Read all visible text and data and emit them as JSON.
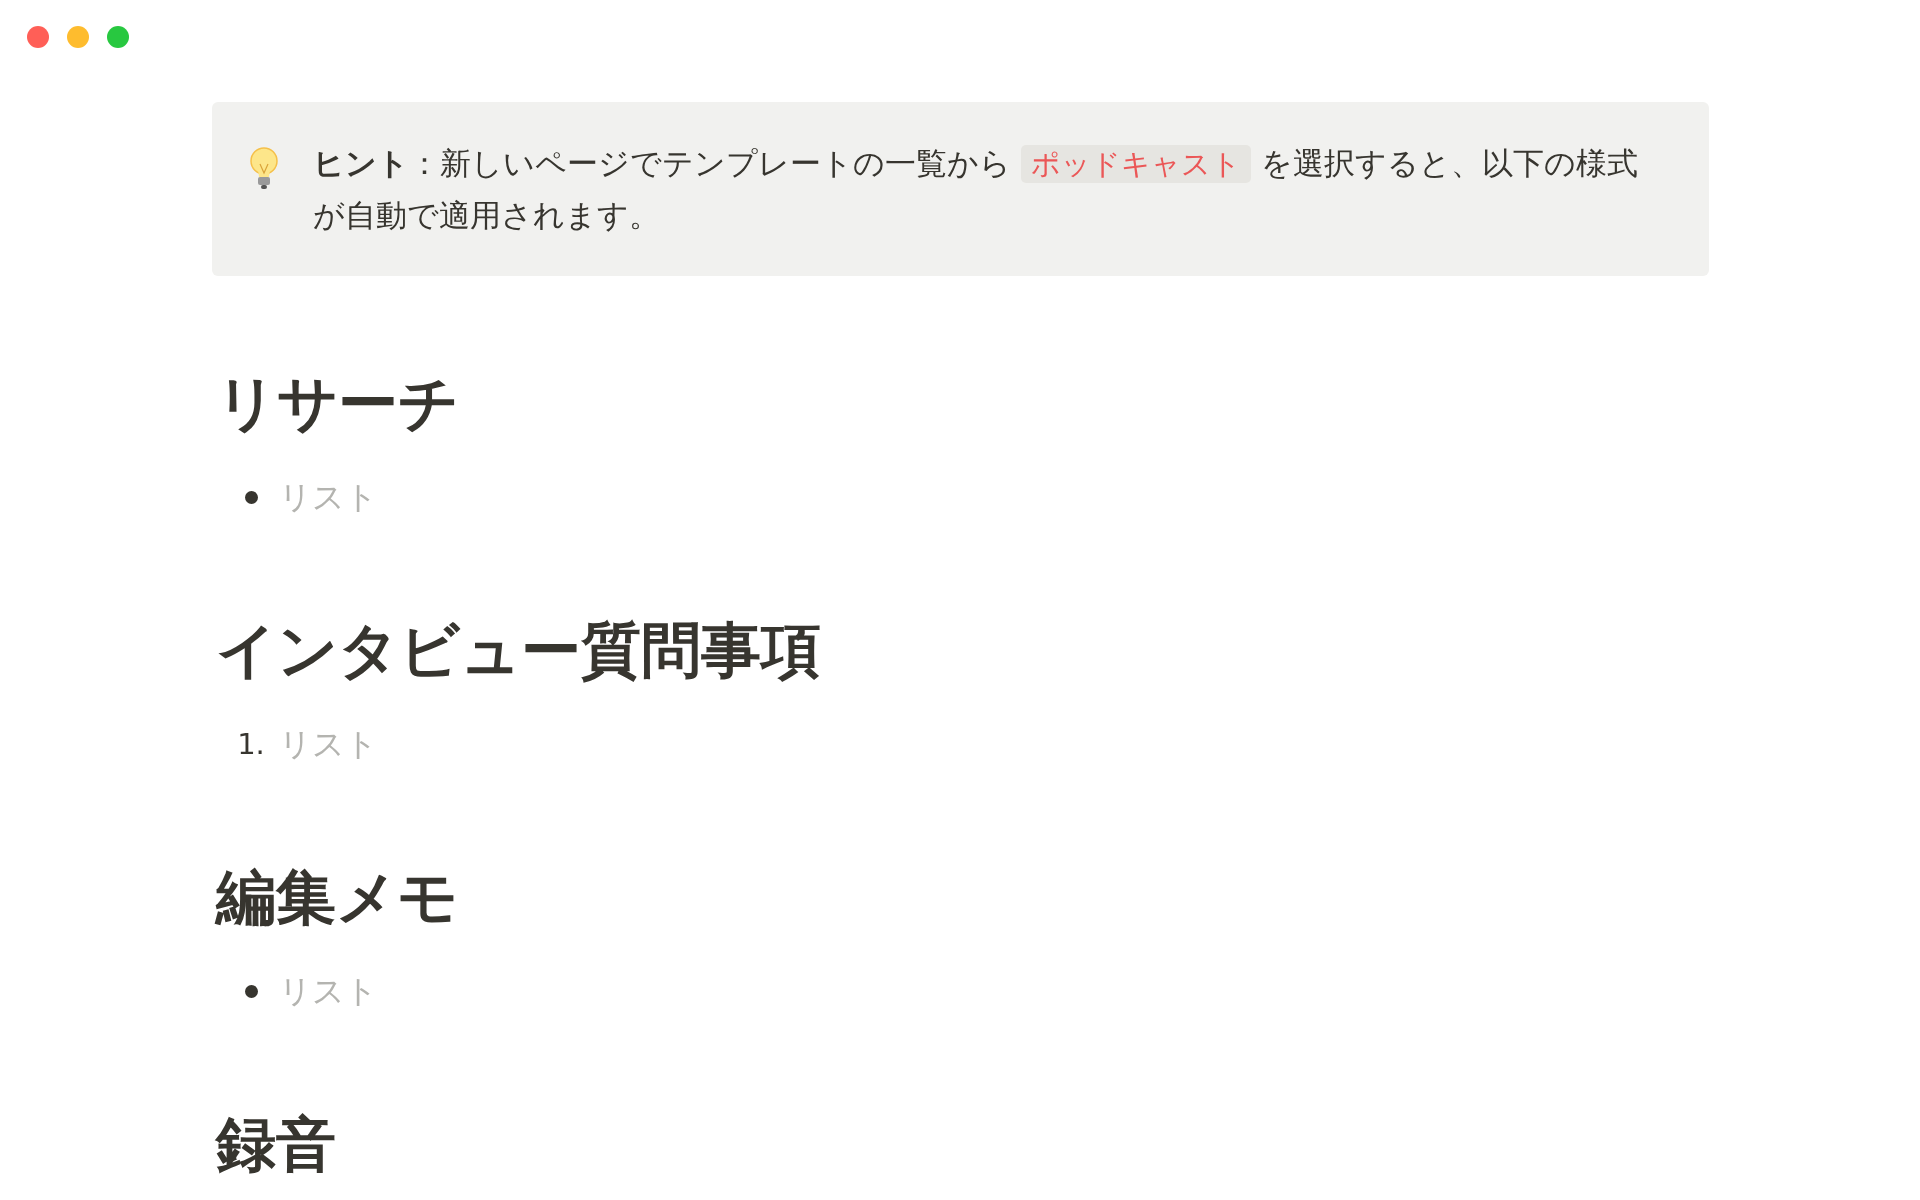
{
  "callout": {
    "segments": [
      {
        "kind": "bold",
        "text": "ヒント"
      },
      {
        "kind": "plain",
        "text": "：新しいページでテンプレートの一覧から "
      },
      {
        "kind": "code",
        "text": "ポッドキャスト"
      },
      {
        "kind": "plain",
        "text": " を選択すると、以下の様式が自動で適用されます。"
      }
    ]
  },
  "sections": [
    {
      "heading": "リサーチ",
      "list": {
        "kind": "bulleted",
        "items": [
          {
            "text": "リスト",
            "placeholder": true
          }
        ]
      }
    },
    {
      "heading": "インタビュー質問事項",
      "list": {
        "kind": "numbered",
        "items": [
          {
            "number": "1.",
            "text": "リスト",
            "placeholder": true
          }
        ]
      }
    },
    {
      "heading": "編集メモ",
      "list": {
        "kind": "bulleted",
        "items": [
          {
            "text": "リスト",
            "placeholder": true
          }
        ]
      }
    },
    {
      "heading": "録音"
    }
  ]
}
